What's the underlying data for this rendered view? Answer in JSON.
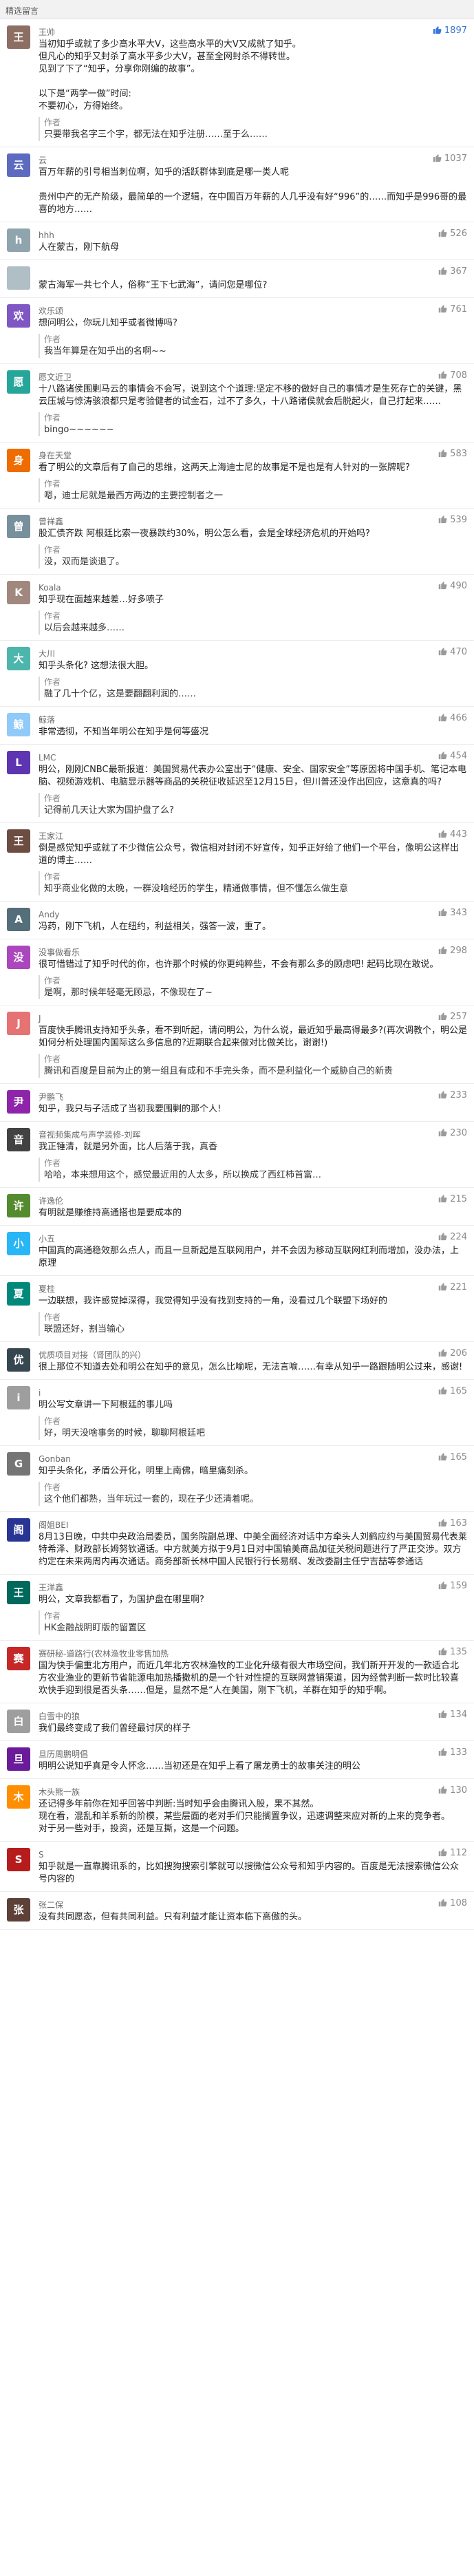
{
  "section_title": "精选留言",
  "reply_author_label": "作者",
  "comments": [
    {
      "nickname": "王帅",
      "avatar_char": "王",
      "avatar_color": "#8d6e63",
      "likes": "1897",
      "liked": true,
      "text": [
        "当初知乎或就了多少高水平大V，这些高水平的大V又成就了知乎。",
        "但凡心的知乎又封杀了高水平多少大V，甚至全网封杀不得转世。",
        "见到了下了“知乎，分享你刚编的故事”。",
        "",
        "以下是“两学一做”时间:",
        "不要初心，方得始终。"
      ],
      "reply": "只要带我名字三个字，都无法在知乎注册……至于么……"
    },
    {
      "nickname": "云",
      "avatar_char": "云",
      "avatar_color": "#5c6bc0",
      "likes": "1037",
      "liked": false,
      "text": [
        "百万年薪的引号相当刺位啊，知乎的活跃群体到底是哪一类人呢",
        "",
        "贵州中产的无产阶级，最简单的一个逻辑，在中国百万年薪的人几乎没有好“996”的……而知乎是996哥的最喜的地方……"
      ],
      "reply": ""
    },
    {
      "nickname": "hhh",
      "avatar_char": "h",
      "avatar_color": "#90a4ae",
      "likes": "526",
      "liked": false,
      "text": [
        "人在蒙古，刚下航母"
      ],
      "reply": ""
    },
    {
      "nickname": "",
      "avatar_char": "",
      "avatar_color": "#b0bec5",
      "likes": "367",
      "liked": false,
      "text": [
        "蒙古海军一共七个人，俗称“王下七武海”，请问您是哪位?"
      ],
      "reply": ""
    },
    {
      "nickname": "欢乐颂",
      "avatar_char": "欢",
      "avatar_color": "#7e57c2",
      "likes": "761",
      "liked": false,
      "text": [
        "想问明公，你玩儿知乎或者微博吗?"
      ],
      "reply": "我当年算是在知乎出的名啊~~"
    },
    {
      "nickname": "愿文近卫",
      "avatar_char": "愿",
      "avatar_color": "#26a69a",
      "likes": "708",
      "liked": false,
      "text": [
        "十八路诸侯围剿马云的事情会不会写，说到这个个道理:坚定不移的做好自己的事情才是生死存亡的关键，黑云压城与惊涛骇浪都只是考验健者的试金石，过不了多久，十八路诸侯就会后脱起火，自己打起来……"
      ],
      "reply": "bingo~~~~~~"
    },
    {
      "nickname": "身在天堂",
      "avatar_char": "身",
      "avatar_color": "#ef6c00",
      "likes": "583",
      "liked": false,
      "text": [
        "看了明公的文章后有了自己的思维，这两天上海迪士尼的故事是不是也是有人针对的一张牌呢?"
      ],
      "reply": "嗯，迪士尼就是最西方两边的主要控制者之一"
    },
    {
      "nickname": "曾祥鑫",
      "avatar_char": "曾",
      "avatar_color": "#78909c",
      "likes": "539",
      "liked": false,
      "text": [
        "股汇债齐跌 阿根廷比索一夜暴跌约30%，明公怎么看，会是全球经济危机的开始吗?"
      ],
      "reply": "没，双而是谈退了。"
    },
    {
      "nickname": "Koala",
      "avatar_char": "K",
      "avatar_color": "#a1887f",
      "likes": "490",
      "liked": false,
      "text": [
        "知乎现在面越来越差…好多喷子"
      ],
      "reply": "以后会越来越多……"
    },
    {
      "nickname": "大川",
      "avatar_char": "大",
      "avatar_color": "#4db6ac",
      "likes": "470",
      "liked": false,
      "text": [
        "知乎头条化? 这想法很大胆。"
      ],
      "reply": "融了几十个亿，这是要翻翻利润的……"
    },
    {
      "nickname": "鲸落",
      "avatar_char": "鲸",
      "avatar_color": "#90caf9",
      "likes": "466",
      "liked": false,
      "text": [
        "非常透彻，不知当年明公在知乎是何等盛况"
      ],
      "reply": ""
    },
    {
      "nickname": "LMC",
      "avatar_char": "L",
      "avatar_color": "#5e35b1",
      "likes": "454",
      "liked": false,
      "text": [
        "明公，刚刚CNBC最新报道：美国贸易代表办公室出于“健康、安全、国家安全”等原因将中国手机、笔记本电脑、视频游戏机、电脑显示器等商品的关税征收延迟至12月15日，但川普还没作出回应，这意真的吗?"
      ],
      "reply": "记得前几天让大家为国护盘了么?"
    },
    {
      "nickname": "王家江",
      "avatar_char": "王",
      "avatar_color": "#6d4c41",
      "likes": "443",
      "liked": false,
      "text": [
        "倒是感觉知乎或就了不少微信公众号，微信相对封闭不好宣传，知乎正好给了他们一个平台，像明公这样出道的博主……"
      ],
      "reply": "知乎商业化做的太晚，一群没啥经历的学生，精通做事情，但不懂怎么做生意"
    },
    {
      "nickname": "Andy",
      "avatar_char": "A",
      "avatar_color": "#546e7a",
      "likes": "343",
      "liked": false,
      "text": [
        "冯药，刚下飞机，人在纽约，利益相关，强答一波，重了。"
      ],
      "reply": ""
    },
    {
      "nickname": "没事做看乐",
      "avatar_char": "没",
      "avatar_color": "#ab47bc",
      "likes": "298",
      "liked": false,
      "text": [
        "很可惜错过了知乎时代的你，也许那个时候的你更纯粹些，不会有那么多的顾虑吧! 起码比现在敢说。"
      ],
      "reply": "是啊，那时候年轻毫无顾忌，不像现在了~"
    },
    {
      "nickname": "J",
      "avatar_char": "J",
      "avatar_color": "#e57373",
      "likes": "257",
      "liked": false,
      "text": [
        "百度快手腾讯支持知乎头条，看不到听起，请问明公，为什么说，最近知乎最高得最多?(再次调教个，明公是如何分析处理国内国际这么多信息的?近期联合起来做对比做关比，谢谢!)"
      ],
      "reply": "腾讯和百度是目前为止的第一组且有成和不手完头条，而不是利益化一个威胁自己的新贵"
    },
    {
      "nickname": "尹鹏飞",
      "avatar_char": "尹",
      "avatar_color": "#8e24aa",
      "likes": "233",
      "liked": false,
      "text": [
        "知乎，我只与子活成了当初我要围剿的那个人!"
      ],
      "reply": ""
    },
    {
      "nickname": "音视频集成与声学装修-刘晖",
      "avatar_char": "音",
      "avatar_color": "#424242",
      "likes": "230",
      "liked": false,
      "text": [
        "我正锤清，就是另外面，比人后落于我，真香"
      ],
      "reply": "哈哈，本来想用这个，感觉最近用的人太多，所以换成了西红柿首富…"
    },
    {
      "nickname": "许逸伦",
      "avatar_char": "许",
      "avatar_color": "#558b2f",
      "likes": "215",
      "liked": false,
      "text": [
        "有明就是赚维持高通搭也是要成本的"
      ],
      "reply": ""
    },
    {
      "nickname": "小五",
      "avatar_char": "小",
      "avatar_color": "#29b6f6",
      "likes": "224",
      "liked": false,
      "text": [
        "中国真的高通稳效那么点人，而且一旦新起是互联网用户，并不会因为移动互联网红利而增加，没办法，上原理"
      ],
      "reply": ""
    },
    {
      "nickname": "夏桂",
      "avatar_char": "夏",
      "avatar_color": "#00897b",
      "likes": "221",
      "liked": false,
      "text": [
        "一边联想，我许感觉掉深得，我觉得知乎没有找到支持的一角，没看过几个联盟下场好的"
      ],
      "reply": "联盟还好，割当输心"
    },
    {
      "nickname": "优质项目对接（肾团队的兴）",
      "avatar_char": "优",
      "avatar_color": "#37474f",
      "likes": "206",
      "liked": false,
      "text": [
        "很上那位不知道去处和明公在知乎的意见，怎么比喻呢，无法言喻……有幸从知乎一路跟随明公过来，感谢!"
      ],
      "reply": ""
    },
    {
      "nickname": "i",
      "avatar_char": "i",
      "avatar_color": "#9e9e9e",
      "likes": "165",
      "liked": false,
      "text": [
        "明公写文章讲一下阿根廷的事儿吗"
      ],
      "reply": "好，明天没啥事务的时候，聊聊阿根廷吧"
    },
    {
      "nickname": "Gonban",
      "avatar_char": "G",
      "avatar_color": "#757575",
      "likes": "165",
      "liked": false,
      "text": [
        "知乎头条化，矛盾公开化，明里上南佛，暗里痛刻杀。"
      ],
      "reply": "这个他们都熟，当年玩过一套的，现在子少还清着呢。"
    },
    {
      "nickname": "阁姐BEI",
      "avatar_char": "阁",
      "avatar_color": "#283593",
      "likes": "163",
      "liked": false,
      "text": [
        "8月13日晚，中共中央政治局委员，国务院副总理、中美全面经济对话中方牵头人刘鹤应约与美国贸易代表莱特希泽、财政部长姆努钦通话。中方就美方拟于9月1日对中国输美商品加征关税问题进行了严正交涉。双方约定在未来两周内再次通话。商务部新长林中国人民银行行长易纲、发改委副主任宁吉喆等参通话"
      ],
      "reply": ""
    },
    {
      "nickname": "王洋鑫",
      "avatar_char": "王",
      "avatar_color": "#00695c",
      "likes": "159",
      "liked": false,
      "text": [
        "明公，文章我都看了，为国护盘在哪里啊?"
      ],
      "reply": "HK金融战阴盯版的留置区"
    },
    {
      "nickname": "赛研秘-道路行(农林渔牧业零售加热",
      "avatar_char": "赛",
      "avatar_color": "#c62828",
      "likes": "135",
      "liked": false,
      "text": [
        "国为快手偏重北方用户，而近几年北方农林渔牧的工业化升级有很大市场空间，我们新开开发的一款适合北方农业渔业的更新节省能源电加热播撒机的是一个针对性提的互联网营销渠道，因为经营判断一款时比较喜欢快手迎到很是否头条……但是，显然不是“人在美国，刚下飞机，羊群在知乎的知乎啊。"
      ],
      "reply": ""
    },
    {
      "nickname": "白雪中的狼",
      "avatar_char": "白",
      "avatar_color": "#9e9e9e",
      "likes": "134",
      "liked": false,
      "text": [
        "我们最终变成了我们曾经最讨厌的样子"
      ],
      "reply": ""
    },
    {
      "nickname": "旦历周鹏明倡",
      "avatar_char": "旦",
      "avatar_color": "#6a1b9a",
      "likes": "133",
      "liked": false,
      "text": [
        "明明公说知乎真是令人怀念……当初还是在知乎上看了屠龙勇士的故事关注的明公"
      ],
      "reply": ""
    },
    {
      "nickname": "木头熊一族",
      "avatar_char": "木",
      "avatar_color": "#ff8f00",
      "likes": "130",
      "liked": false,
      "text": [
        "还记得多年前你在知乎回答中判断:当时知乎会由腾讯入股，果不其然。",
        "现在看，混乱和羊系新的阶模，某些层面的老对手们只能搁置争议，迅速调整来应对新的上来的竞争者。",
        "对于另一些对手，投资，还是互撕，这是一个问题。"
      ],
      "reply": ""
    },
    {
      "nickname": "S",
      "avatar_char": "S",
      "avatar_color": "#b71c1c",
      "likes": "112",
      "liked": false,
      "text": [
        "知乎就是一直靠腾讯系的，比如搜狗搜索引擎就可以搜微信公众号和知乎内容的。百度是无法搜索微信公众号内容的"
      ],
      "reply": ""
    },
    {
      "nickname": "张二保",
      "avatar_char": "张",
      "avatar_color": "#5d4037",
      "likes": "108",
      "liked": false,
      "text": [
        "没有共同愿态，但有共同利益。只有利益才能让资本临下高傲的头。"
      ],
      "reply": ""
    }
  ]
}
